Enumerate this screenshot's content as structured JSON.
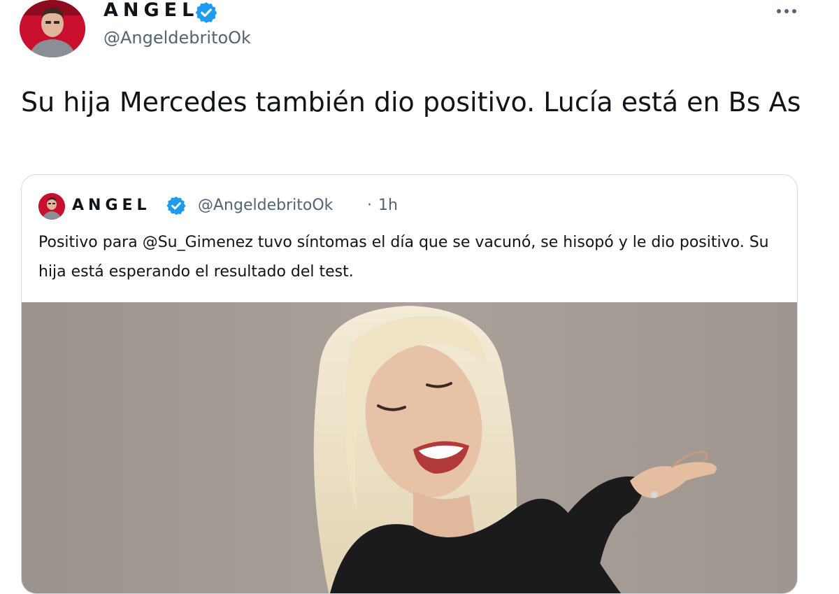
{
  "tweet": {
    "author": {
      "name": "ANGEL",
      "handle": "@AngeldebritoOk",
      "avatar_icon": "profile-photo"
    },
    "verified_icon": "verified-badge-icon",
    "more_icon": "more-dots-icon",
    "text": "Su hija Mercedes también dio positivo. Lucía está en Bs As"
  },
  "quoted_tweet": {
    "author": {
      "name": "ANGEL",
      "handle": "@AngeldebritoOk",
      "avatar_icon": "profile-photo"
    },
    "separator": "·",
    "time": "1h",
    "text": "Positivo para @Su_Gimenez tuvo síntomas el día que se vacunó, se hisopó y le dio positivo. Su hija está esperando el resultado del test.",
    "media": {
      "kind": "photo",
      "icon": "photo-blonde-woman"
    }
  },
  "colors": {
    "text_primary": "#0f1419",
    "text_secondary": "#536471",
    "verified_blue": "#1d9bf0",
    "border": "#cfd9de",
    "photo_background": "#a39a93"
  }
}
